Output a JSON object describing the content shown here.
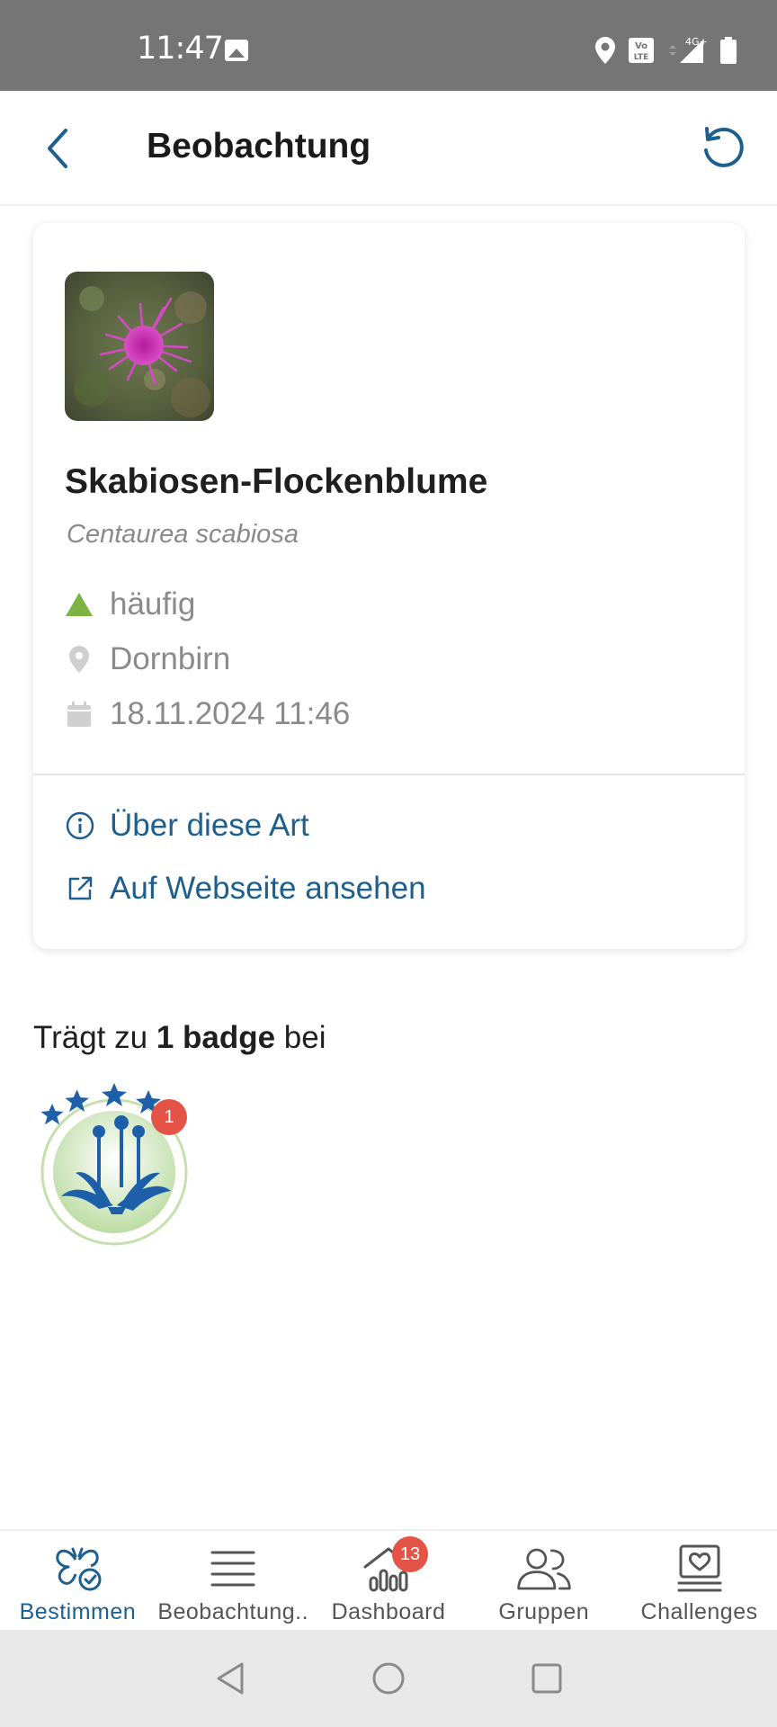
{
  "status_bar": {
    "time": "11:47",
    "network": "4G+"
  },
  "header": {
    "title": "Beobachtung"
  },
  "observation": {
    "common_name": "Skabiosen-Flockenblume",
    "scientific_name": "Centaurea scabiosa",
    "abundance": "häufig",
    "location": "Dornbirn",
    "datetime": "18.11.2024 11:46",
    "abundance_color": "#7cb342"
  },
  "links": {
    "about_species": "Über diese Art",
    "view_website": "Auf Webseite ansehen"
  },
  "badges": {
    "heading_prefix": "Trägt zu ",
    "heading_bold": "1 badge",
    "heading_suffix": " bei",
    "items": [
      {
        "icon": "dandelion-badge-icon",
        "count": "1"
      }
    ]
  },
  "bottom_nav": {
    "items": [
      {
        "label": "Bestimmen",
        "icon": "butterfly-check-icon",
        "active": true
      },
      {
        "label": "Beobachtung..",
        "icon": "list-icon"
      },
      {
        "label": "Dashboard",
        "icon": "dashboard-home-icon",
        "badge": "13"
      },
      {
        "label": "Gruppen",
        "icon": "group-icon"
      },
      {
        "label": "Challenges",
        "icon": "challenge-heart-icon"
      }
    ]
  },
  "colors": {
    "accent": "#1d5f8e",
    "badge_red": "#e35346",
    "status_bar": "#757575"
  }
}
